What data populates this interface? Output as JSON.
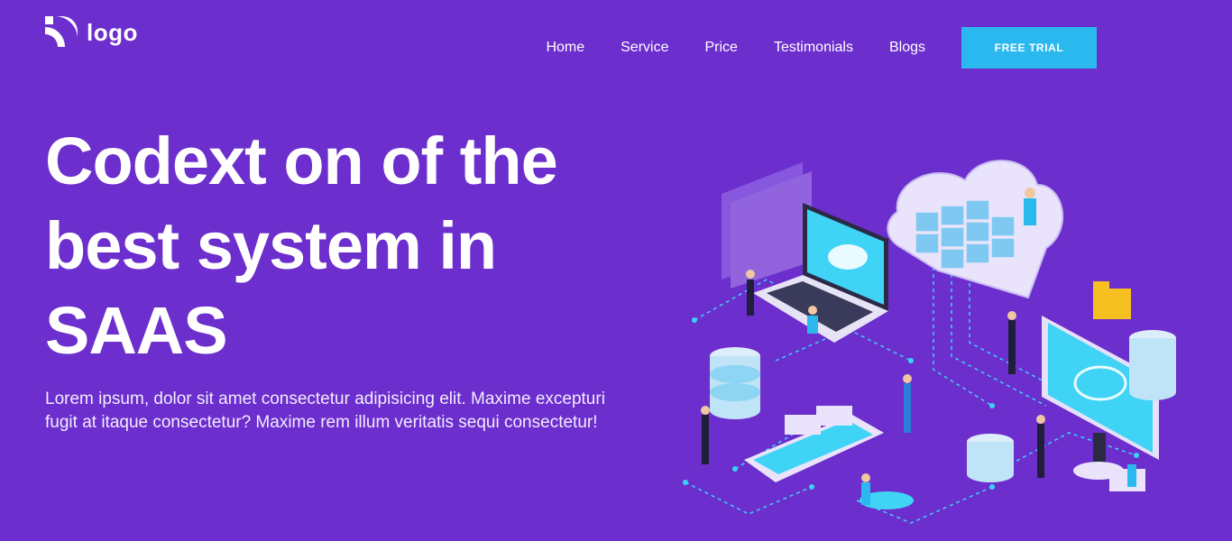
{
  "header": {
    "logo_text": "logo",
    "nav": [
      "Home",
      "Service",
      "Price",
      "Testimonials",
      "Blogs"
    ],
    "cta_label": "FREE TRIAL"
  },
  "hero": {
    "title": "Codext on of the best system in SAAS",
    "text": "Lorem ipsum, dolor sit amet consectetur adipisicing elit. Maxime excepturi fugit at itaque consectetur? Maxime rem illum veritatis sequi consectetur!"
  },
  "colors": {
    "background": "#6c2ecd",
    "cta": "#2bb8ee",
    "accent": "#39d4f5"
  },
  "icons": [
    "logo-icon",
    "saas-isometric-illustration"
  ]
}
